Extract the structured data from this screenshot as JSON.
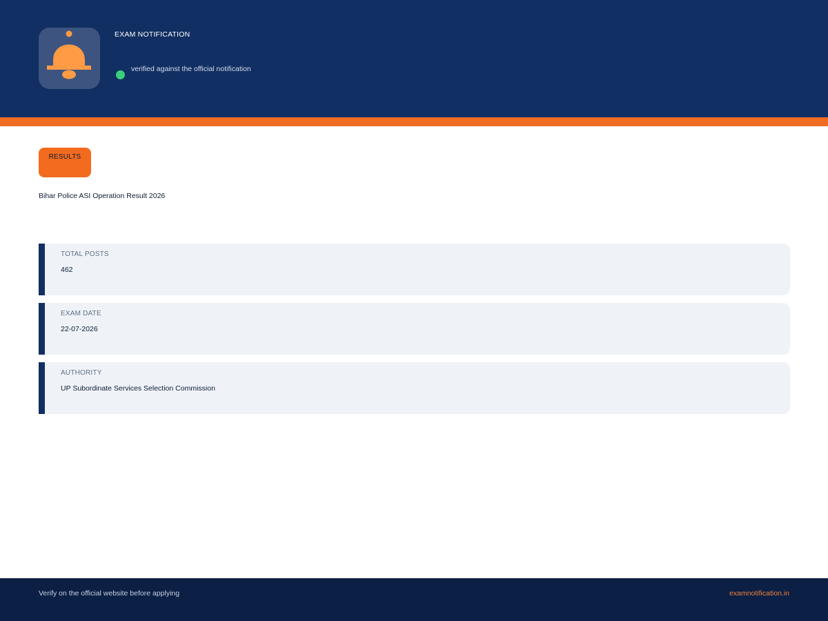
{
  "header": {
    "title": "EXAM NOTIFICATION",
    "verified_text": "verified against the official notification",
    "logo_icon": "bell-icon"
  },
  "notification": {
    "category": "RESULTS",
    "title": "Bihar Police ASI Operation Result 2026"
  },
  "details": [
    {
      "label": "TOTAL POSTS",
      "value": "462"
    },
    {
      "label": "EXAM DATE",
      "value": "22-07-2026"
    },
    {
      "label": "AUTHORITY",
      "value": "UP Subordinate Services Selection Commission"
    }
  ],
  "footer": {
    "note": "Verify on the official website before applying",
    "site": "examnotification.in"
  },
  "colors": {
    "header_bg": "#112f62",
    "accent": "#ef6c22",
    "verified": "#3ad07a",
    "card_bg": "#eff3f8",
    "footer_bg": "#0c1f45"
  }
}
